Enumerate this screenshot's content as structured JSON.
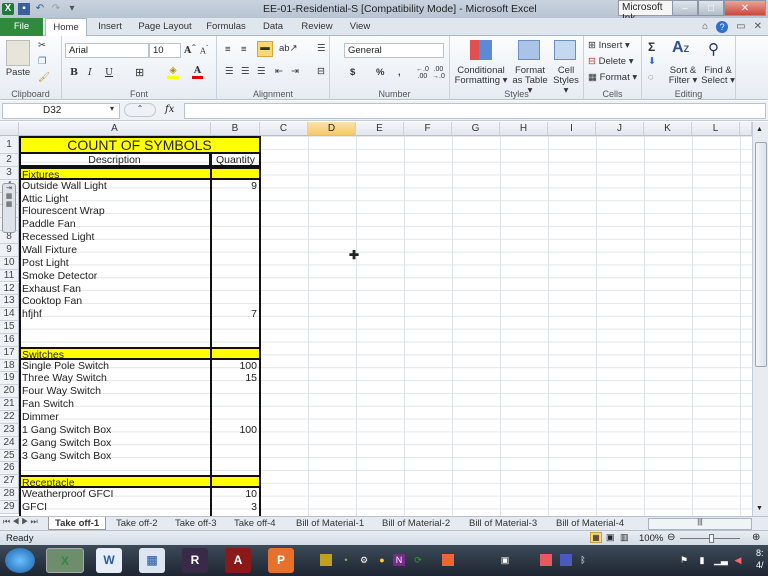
{
  "window": {
    "title": "EE-01-Residential-S  [Compatibility Mode] - Microsoft Excel",
    "ink_tool": "Microsoft Ink",
    "controls": {
      "minimize": "–",
      "maximize": "□",
      "close": "✕"
    }
  },
  "quick_access": {
    "icons": [
      "excel-logo-icon",
      "save-icon",
      "undo-icon",
      "redo-icon",
      "customize-icon"
    ]
  },
  "tabs": [
    {
      "label": "File"
    },
    {
      "label": "Home"
    },
    {
      "label": "Insert"
    },
    {
      "label": "Page Layout"
    },
    {
      "label": "Formulas"
    },
    {
      "label": "Data"
    },
    {
      "label": "Review"
    },
    {
      "label": "View"
    }
  ],
  "ribbon": {
    "clipboard": {
      "label": "Clipboard",
      "paste": "Paste"
    },
    "font": {
      "label": "Font",
      "name": "Arial",
      "size": "10",
      "bold": "B",
      "italic": "I",
      "underline": "U"
    },
    "alignment": {
      "label": "Alignment"
    },
    "number": {
      "label": "Number",
      "format": "General",
      "currency": "$",
      "percent": "%",
      "comma": ","
    },
    "styles": {
      "label": "Styles",
      "conditional": "Conditional",
      "conditional2": "Formatting ▾",
      "format_table": "Format",
      "format_table2": "as Table ▾",
      "cell_styles": "Cell",
      "cell_styles2": "Styles ▾"
    },
    "cells": {
      "label": "Cells",
      "insert": "Insert ▾",
      "delete": "Delete ▾",
      "format": "Format ▾"
    },
    "editing": {
      "label": "Editing",
      "sort": "Sort &",
      "sort2": "Filter ▾",
      "find": "Find &",
      "find2": "Select ▾"
    }
  },
  "formula_bar": {
    "name_box": "D32",
    "fx": "fx",
    "value": ""
  },
  "columns": [
    "A",
    "B",
    "C",
    "D",
    "E",
    "F",
    "G",
    "H",
    "I",
    "J",
    "K",
    "L"
  ],
  "selected_column": "D",
  "rows": [
    {
      "n": "1",
      "a": "COUNT OF SYMBOLS",
      "b": "",
      "style": "title"
    },
    {
      "n": "2",
      "a": "Description",
      "b": "Quantity",
      "style": "header"
    },
    {
      "n": "3",
      "a": "Fixtures",
      "b": "",
      "style": "section"
    },
    {
      "n": "4",
      "a": "Outside Wall Light",
      "b": "9"
    },
    {
      "n": "5",
      "a": "Attic Light",
      "b": ""
    },
    {
      "n": "6",
      "a": "Flourescent Wrap",
      "b": ""
    },
    {
      "n": "7",
      "a": "Paddle Fan",
      "b": ""
    },
    {
      "n": "8",
      "a": "Recessed Light",
      "b": ""
    },
    {
      "n": "9",
      "a": "Wall Fixture",
      "b": ""
    },
    {
      "n": "10",
      "a": "Post Light",
      "b": ""
    },
    {
      "n": "11",
      "a": "Smoke Detector",
      "b": ""
    },
    {
      "n": "12",
      "a": "Exhaust Fan",
      "b": ""
    },
    {
      "n": "13",
      "a": "Cooktop Fan",
      "b": ""
    },
    {
      "n": "14",
      "a": "hfjhf",
      "b": "7"
    },
    {
      "n": "15",
      "a": "",
      "b": ""
    },
    {
      "n": "16",
      "a": "",
      "b": ""
    },
    {
      "n": "17",
      "a": "Switches",
      "b": "",
      "style": "section"
    },
    {
      "n": "18",
      "a": "Single Pole Switch",
      "b": "100"
    },
    {
      "n": "19",
      "a": "Three Way Switch",
      "b": "15"
    },
    {
      "n": "20",
      "a": "Four Way Switch",
      "b": ""
    },
    {
      "n": "21",
      "a": "Fan Switch",
      "b": ""
    },
    {
      "n": "22",
      "a": "Dimmer",
      "b": ""
    },
    {
      "n": "23",
      "a": "1 Gang Switch Box",
      "b": "100"
    },
    {
      "n": "24",
      "a": "2 Gang Switch Box",
      "b": ""
    },
    {
      "n": "25",
      "a": "3 Gang Switch Box",
      "b": ""
    },
    {
      "n": "26",
      "a": "",
      "b": ""
    },
    {
      "n": "27",
      "a": "Receptacle",
      "b": "",
      "style": "section"
    },
    {
      "n": "28",
      "a": "Weatherproof GFCI",
      "b": "10"
    },
    {
      "n": "29",
      "a": "GFCI",
      "b": "3"
    }
  ],
  "sheet_tabs": [
    {
      "label": "Take off-1",
      "active": true
    },
    {
      "label": "Take off-2"
    },
    {
      "label": "Take off-3"
    },
    {
      "label": "Take off-4"
    },
    {
      "label": "Bill of Material-1"
    },
    {
      "label": "Bill of Material-2"
    },
    {
      "label": "Bill of Material-3"
    },
    {
      "label": "Bill of Material-4"
    }
  ],
  "status": {
    "ready": "Ready",
    "zoom": "100%"
  },
  "taskbar": {
    "apps": [
      "Excel",
      "Word",
      "Calculator",
      "Rx",
      "Autodesk",
      "PowerPoint"
    ],
    "tray_icons": [
      "onenote-icon",
      "network-icon",
      "sync-icon",
      "settings-icon",
      "shield-icon",
      "bluetooth-icon",
      "flag-icon",
      "power-icon",
      "signal-icon",
      "volume-icon"
    ],
    "clock": "8:",
    "date": "4/"
  }
}
